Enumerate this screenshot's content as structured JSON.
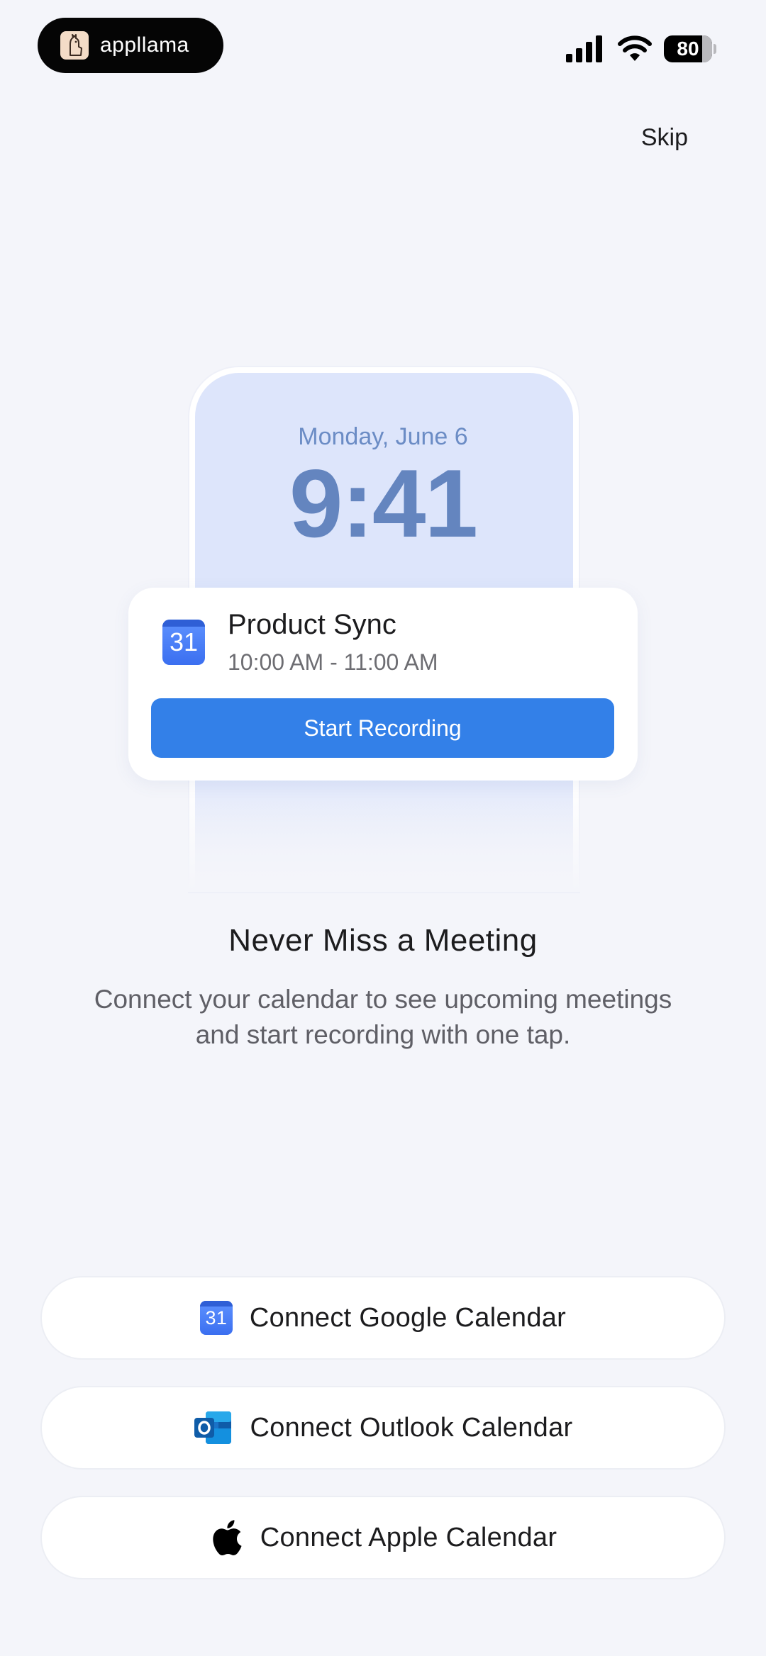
{
  "status_bar": {
    "brand": "appllama",
    "battery": "80"
  },
  "header": {
    "skip_label": "Skip"
  },
  "preview": {
    "date": "Monday, June 6",
    "time": "9:41",
    "meeting": {
      "calendar_day": "31",
      "title": "Product Sync",
      "time_range": "10:00 AM - 11:00 AM",
      "button_label": "Start Recording"
    }
  },
  "content": {
    "headline": "Never Miss a Meeting",
    "subtext_line1": "Connect your calendar to see upcoming meetings",
    "subtext_line2": "and start recording with one tap."
  },
  "actions": {
    "google": {
      "label": "Connect Google Calendar",
      "icon": "google-calendar-icon",
      "icon_text": "31"
    },
    "outlook": {
      "label": "Connect Outlook Calendar",
      "icon": "outlook-icon"
    },
    "apple": {
      "label": "Connect Apple Calendar",
      "icon": "apple-icon"
    }
  },
  "colors": {
    "accent": "#3380e8",
    "background": "#f4f5fa",
    "lock_text": "#6485bf"
  }
}
